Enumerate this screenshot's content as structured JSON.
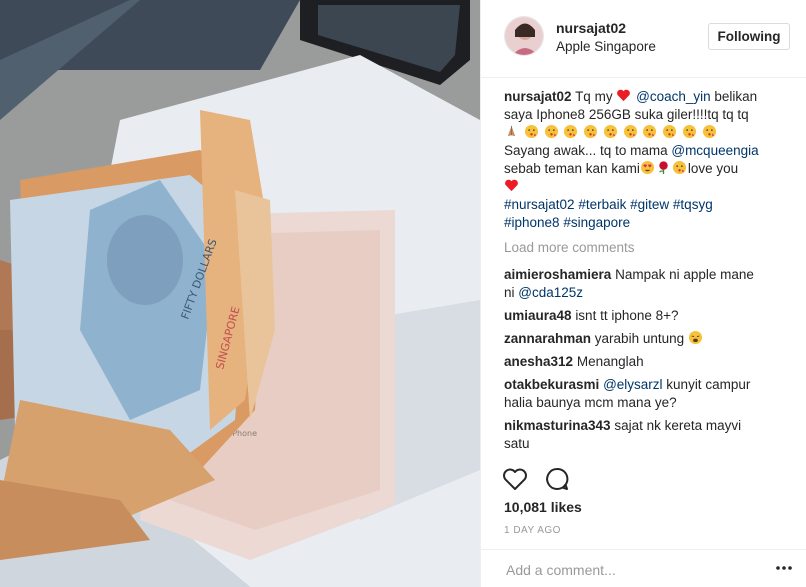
{
  "post": {
    "username": "nursajat02",
    "location": "Apple Singapore",
    "follow_label": "Following",
    "likes": "10,081 likes",
    "time_ago": "1 DAY AGO",
    "add_comment_placeholder": "Add a comment..."
  },
  "caption": {
    "username": "nursajat02",
    "l1_a": "Tq my",
    "l1_mention": "@coach_yin",
    "l1_b": "belikan",
    "l2": "saya Iphone8 256GB suka giler!!!!tq tq tq",
    "l4": "Sayang awak... tq to mama",
    "l4_mention": "@mcqueengia",
    "l5_a": "sebab teman kan kami",
    "l5_b": "love you",
    "tags1": [
      "#nursajat02",
      "#terbaik",
      "#gitew",
      "#tqsyg"
    ],
    "tags2": [
      "#iphone8",
      "#singapore"
    ]
  },
  "load_more": "Load more comments",
  "comments": [
    {
      "user": "aimieroshamiera",
      "text": "Nampak ni apple mane",
      "text2": "ni",
      "mention": "@cda125z"
    },
    {
      "user": "umiaura48",
      "text": "isnt tt iphone 8+?"
    },
    {
      "user": "zannarahman",
      "text": "yarabih untung"
    },
    {
      "user": "anesha312",
      "text": "Menanglah"
    },
    {
      "user": "otakbekurasmi",
      "mention": "@elysarzl",
      "text": "kunyit campur",
      "text2": "halia baunya mcm mana ye?"
    },
    {
      "user": "nikmasturina343",
      "text": "sajat nk kereta mayvi",
      "text2": "satu"
    }
  ],
  "colors": {
    "heart_red": "#ed1c24",
    "link_blue": "#003569",
    "muted_gray": "#999999",
    "text": "#262626"
  },
  "icons": [
    "heart-icon",
    "comment-icon",
    "more-options-icon"
  ]
}
